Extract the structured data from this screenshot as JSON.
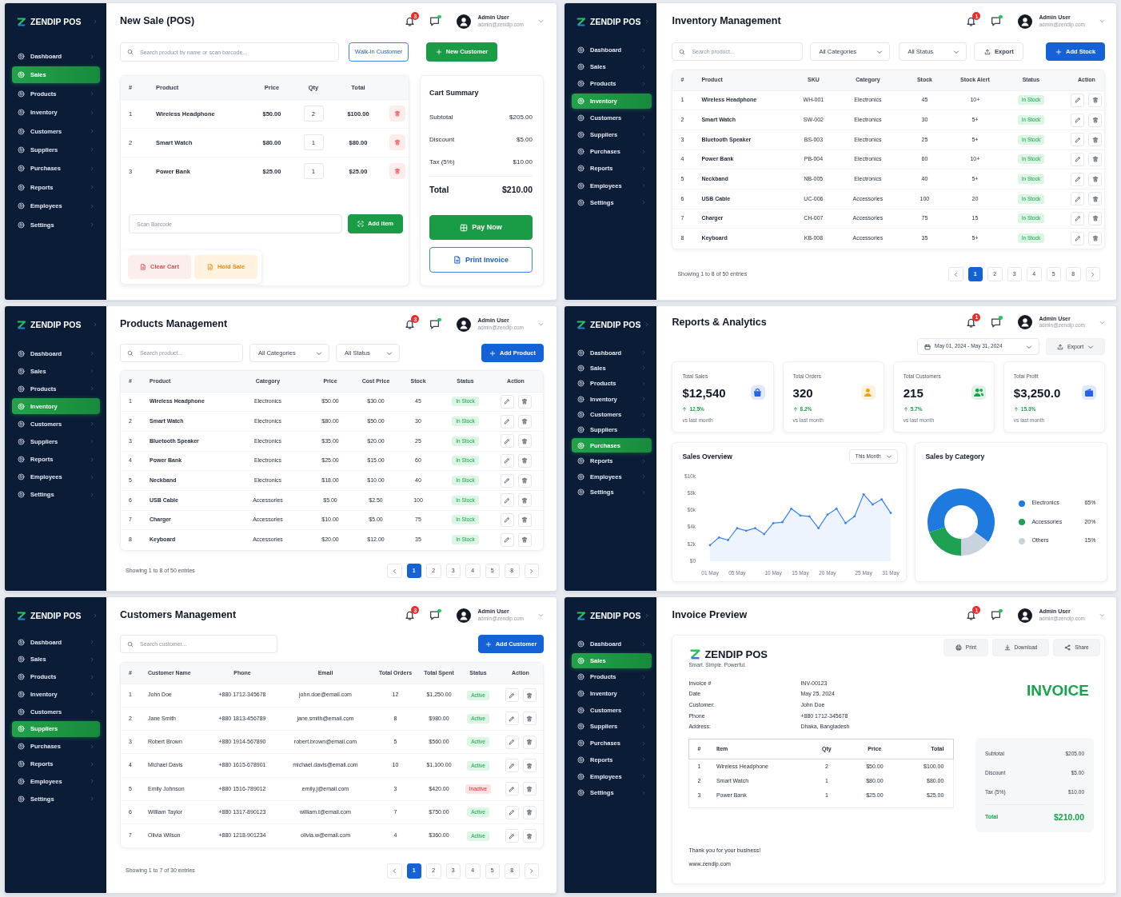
{
  "screens": [
    {
      "kind": "pos",
      "brand": "ZENDIP POS",
      "nav": [
        {
          "label": "Dashboard",
          "selected": false
        },
        {
          "label": "Sales",
          "selected": true
        },
        {
          "label": "Products",
          "selected": false
        },
        {
          "label": "Inventory",
          "selected": false
        },
        {
          "label": "Customers",
          "selected": false
        },
        {
          "label": "Suppliers",
          "selected": false
        },
        {
          "label": "Purchases",
          "selected": false
        },
        {
          "label": "Reports",
          "selected": false
        },
        {
          "label": "Employees",
          "selected": false
        },
        {
          "label": "Settings",
          "selected": false
        }
      ],
      "header": {
        "title": "New Sale (POS)",
        "notifications": "3",
        "user_name": "Admin User",
        "user_email": "admin@zendip.com"
      },
      "search": {
        "placeholder": "Search product by name or scan barcode..."
      },
      "customer_button": "Walk-in Customer",
      "new_customer_button": "New Customer",
      "cart": {
        "columns": [
          "#",
          "Product",
          "Price",
          "Qty",
          "Total"
        ],
        "rows": [
          [
            "1",
            "Wireless Headphone",
            "$50.00",
            "2",
            "$100.00"
          ],
          [
            "2",
            "Smart Watch",
            "$80.00",
            "1",
            "$80.00"
          ],
          [
            "3",
            "Power Bank",
            "$25.00",
            "1",
            "$25.00"
          ]
        ]
      },
      "barcode": {
        "placeholder": "Scan Barcode"
      },
      "add_item_button": "Add Item",
      "clear_cart_button": "Clear Cart",
      "hold_sale_button": "Hold Sale",
      "summary": {
        "title": "Cart Summary",
        "lines": [
          {
            "label": "Subtotal",
            "value": "$205.00"
          },
          {
            "label": "Discount",
            "value": "$5.00"
          },
          {
            "label": "Tax (5%)",
            "value": "$10.00"
          }
        ],
        "total": {
          "label": "Total",
          "value": "$210.00"
        }
      },
      "pay_button": "Pay Now",
      "print_button": "Print Invoice"
    },
    {
      "kind": "inventory",
      "brand": "ZENDIP POS",
      "nav": [
        {
          "label": "Dashboard",
          "selected": false
        },
        {
          "label": "Sales",
          "selected": false
        },
        {
          "label": "Products",
          "selected": false
        },
        {
          "label": "Inventory",
          "selected": true
        },
        {
          "label": "Customers",
          "selected": false
        },
        {
          "label": "Suppliers",
          "selected": false
        },
        {
          "label": "Purchases",
          "selected": false
        },
        {
          "label": "Reports",
          "selected": false
        },
        {
          "label": "Employees",
          "selected": false
        },
        {
          "label": "Settings",
          "selected": false
        }
      ],
      "header": {
        "title": "Inventory Management",
        "notifications": "1",
        "user_name": "Admin User",
        "user_email": "admin@zendip.com"
      },
      "toolbar": {
        "search_placeholder": "Search product...",
        "filters": [
          "All Categories",
          "All Status"
        ],
        "export_button": "Export",
        "add_button": "Add Stock"
      },
      "table": {
        "columns": [
          "#",
          "Product",
          "SKU",
          "Category",
          "Stock",
          "Stock Alert",
          "Status",
          "Action"
        ],
        "rows": [
          {
            "cells": [
              "1",
              "Wireless Headphone",
              "WH-001",
              "Electronics",
              "45",
              "10+"
            ],
            "status": "In Stock",
            "in_stock": true
          },
          {
            "cells": [
              "2",
              "Smart Watch",
              "SW-002",
              "Electronics",
              "30",
              "5+"
            ],
            "status": "In Stock",
            "in_stock": true
          },
          {
            "cells": [
              "3",
              "Bluetooth Speaker",
              "BS-003",
              "Electronics",
              "25",
              "5+"
            ],
            "status": "In Stock",
            "in_stock": true
          },
          {
            "cells": [
              "4",
              "Power Bank",
              "PB-004",
              "Electronics",
              "60",
              "10+"
            ],
            "status": "In Stock",
            "in_stock": true
          },
          {
            "cells": [
              "5",
              "Neckband",
              "NB-005",
              "Electronics",
              "40",
              "5+"
            ],
            "status": "In Stock",
            "in_stock": true
          },
          {
            "cells": [
              "6",
              "USB Cable",
              "UC-006",
              "Accessories",
              "100",
              "20"
            ],
            "status": "In Stock",
            "in_stock": true
          },
          {
            "cells": [
              "7",
              "Charger",
              "CH-007",
              "Accessories",
              "75",
              "15"
            ],
            "status": "In Stock",
            "in_stock": true
          },
          {
            "cells": [
              "8",
              "Keyboard",
              "KB-008",
              "Accessories",
              "35",
              "5+"
            ],
            "status": "In Stock",
            "in_stock": true
          }
        ]
      },
      "footer": {
        "summary": "Showing 1 to 8 of 50 entries",
        "pages": [
          {
            "label": "1",
            "selected": true
          },
          {
            "label": "2",
            "selected": false
          },
          {
            "label": "3",
            "selected": false
          },
          {
            "label": "4",
            "selected": false
          },
          {
            "label": "5",
            "selected": false
          },
          {
            "label": "8",
            "selected": false
          }
        ]
      }
    },
    {
      "kind": "products",
      "brand": "ZENDIP POS",
      "nav": [
        {
          "label": "Dashboard",
          "selected": false
        },
        {
          "label": "Sales",
          "selected": false
        },
        {
          "label": "Products",
          "selected": false
        },
        {
          "label": "Inventory",
          "selected": true
        },
        {
          "label": "Customers",
          "selected": false
        },
        {
          "label": "Suppliers",
          "selected": false
        },
        {
          "label": "Reports",
          "selected": false
        },
        {
          "label": "Employees",
          "selected": false
        },
        {
          "label": "Settings",
          "selected": false
        }
      ],
      "header": {
        "title": "Products Management",
        "notifications": "3",
        "user_name": "Admin User",
        "user_email": "admin@zendip.com"
      },
      "toolbar": {
        "search_placeholder": "Search product...",
        "filters": [
          "All Categories",
          "All Status"
        ],
        "add_button": "Add Product"
      },
      "table": {
        "columns": [
          "#",
          "Product",
          "Category",
          "Price",
          "Cost Price",
          "Stock",
          "Status",
          "Action"
        ],
        "rows": [
          {
            "cells": [
              "1",
              "Wireless Headphone",
              "Electronics",
              "$50.00",
              "$30.00",
              "45"
            ],
            "status": "In Stock",
            "in_stock": true
          },
          {
            "cells": [
              "2",
              "Smart Watch",
              "Electronics",
              "$80.00",
              "$50.00",
              "30"
            ],
            "status": "In Stock",
            "in_stock": true
          },
          {
            "cells": [
              "3",
              "Bluetooth Speaker",
              "Electronics",
              "$35.00",
              "$20.00",
              "25"
            ],
            "status": "In Stock",
            "in_stock": true
          },
          {
            "cells": [
              "4",
              "Power Bank",
              "Electronics",
              "$25.00",
              "$15.00",
              "60"
            ],
            "status": "In Stock",
            "in_stock": true
          },
          {
            "cells": [
              "5",
              "Neckband",
              "Electronics",
              "$18.00",
              "$10.00",
              "40"
            ],
            "status": "In Stock",
            "in_stock": true
          },
          {
            "cells": [
              "6",
              "USB Cable",
              "Accessories",
              "$5.00",
              "$2.50",
              "100"
            ],
            "status": "In Stock",
            "in_stock": true
          },
          {
            "cells": [
              "7",
              "Charger",
              "Accessories",
              "$10.00",
              "$5.00",
              "75"
            ],
            "status": "In Stock",
            "in_stock": true
          },
          {
            "cells": [
              "8",
              "Keyboard",
              "Accessories",
              "$20.00",
              "$12.00",
              "35"
            ],
            "status": "In Stock",
            "in_stock": true
          }
        ]
      },
      "footer": {
        "summary": "Showing 1 to 8 of 50 entries",
        "pages": [
          {
            "label": "1",
            "selected": true
          },
          {
            "label": "2",
            "selected": false
          },
          {
            "label": "3",
            "selected": false
          },
          {
            "label": "4",
            "selected": false
          },
          {
            "label": "5",
            "selected": false
          },
          {
            "label": "8",
            "selected": false
          }
        ]
      }
    },
    {
      "kind": "reports",
      "brand": "ZENDIP POS",
      "nav": [
        {
          "label": "Dashboard",
          "selected": false
        },
        {
          "label": "Sales",
          "selected": false
        },
        {
          "label": "Products",
          "selected": false
        },
        {
          "label": "Inventory",
          "selected": false
        },
        {
          "label": "Customers",
          "selected": false
        },
        {
          "label": "Suppliers",
          "selected": false
        },
        {
          "label": "Purchases",
          "selected": true
        },
        {
          "label": "Reports",
          "selected": false
        },
        {
          "label": "Employees",
          "selected": false
        },
        {
          "label": "Settings",
          "selected": false
        }
      ],
      "header": {
        "title": "Reports & Analytics",
        "notifications": "1",
        "user_name": "Admin User",
        "user_email": "admin@zendip.com"
      },
      "date_range": "May 01, 2024 - May 31, 2024",
      "export_button": "Export",
      "stats": [
        {
          "label": "Total Sales",
          "value": "$12,540",
          "change": "12.5%",
          "note": "vs last month",
          "color": "#2563eb"
        },
        {
          "label": "Total Orders",
          "value": "320",
          "change": "8.2%",
          "note": "vs last month",
          "color": "#f59e0b"
        },
        {
          "label": "Total Customers",
          "value": "215",
          "change": "5.7%",
          "note": "vs last month",
          "color": "#16a34a"
        },
        {
          "label": "Total Profit",
          "value": "$3,250.0",
          "change": "15.3%",
          "note": "vs last month",
          "color": "#2563eb"
        }
      ],
      "sales_chart": {
        "period": "This Month",
        "chart_data": {
          "type": "area",
          "title": "Sales Overview",
          "categories": [
            "01 May",
            null,
            null,
            "05 May",
            null,
            null,
            null,
            "10 May",
            null,
            null,
            "15 May",
            null,
            null,
            "20 May",
            null,
            null,
            null,
            "25 May",
            null,
            null,
            "31 May"
          ],
          "series": [
            {
              "color": "#3b82f6",
              "values": [
                1900,
                2800,
                2500,
                3900,
                3600,
                3900,
                3200,
                4500,
                4600,
                6200,
                5400,
                5300,
                3900,
                5500,
                6200,
                4500,
                5300,
                7900,
                6700,
                7300,
                5700
              ]
            }
          ],
          "ylim": [
            0,
            10000
          ],
          "yticks": [
            {
              "value": 0,
              "label": "$0"
            },
            {
              "value": 2000,
              "label": "$2k"
            },
            {
              "value": 4000,
              "label": "$4k"
            },
            {
              "value": 6000,
              "label": "$6k"
            },
            {
              "value": 8000,
              "label": "$8k"
            },
            {
              "value": 10000,
              "label": "$10k"
            }
          ]
        }
      },
      "category_chart": {
        "chart_data": {
          "type": "donut",
          "title": "Sales by Category",
          "categories": [
            "Electronics",
            "Accessories",
            "Others"
          ],
          "values": [
            65,
            20,
            15
          ],
          "value_labels": [
            "65%",
            "20%",
            "15%"
          ]
        },
        "slices": [
          {
            "color": "#1f7ae0"
          },
          {
            "color": "#1fa152"
          },
          {
            "color": "#c9d3de"
          }
        ]
      }
    },
    {
      "kind": "customers",
      "brand": "ZENDIP POS",
      "nav": [
        {
          "label": "Dashboard",
          "selected": false
        },
        {
          "label": "Sales",
          "selected": false
        },
        {
          "label": "Products",
          "selected": false
        },
        {
          "label": "Inventory",
          "selected": false
        },
        {
          "label": "Customers",
          "selected": false
        },
        {
          "label": "Suppliers",
          "selected": true
        },
        {
          "label": "Purchases",
          "selected": false
        },
        {
          "label": "Reports",
          "selected": false
        },
        {
          "label": "Employees",
          "selected": false
        },
        {
          "label": "Settings",
          "selected": false
        }
      ],
      "header": {
        "title": "Customers Management",
        "notifications": "3",
        "user_name": "Admin User",
        "user_email": "admin@zendip.com"
      },
      "toolbar": {
        "search_placeholder": "Search customer...",
        "add_button": "Add Customer"
      },
      "table": {
        "columns": [
          "#",
          "Customer Name",
          "Phone",
          "Email",
          "Total Orders",
          "Total Spent",
          "Status",
          "Action"
        ],
        "rows": [
          {
            "cells": [
              "1",
              "John Doe",
              "+880 1712-345678",
              "john.doe@email.com",
              "12",
              "$1,250.00"
            ],
            "status": "Active",
            "active": true
          },
          {
            "cells": [
              "2",
              "Jane Smith",
              "+880 1813-456789",
              "jane.smith@email.com",
              "8",
              "$980.00"
            ],
            "status": "Active",
            "active": true
          },
          {
            "cells": [
              "3",
              "Robert Brown",
              "+880 1914-567890",
              "robert.brown@email.com",
              "5",
              "$560.00"
            ],
            "status": "Active",
            "active": true
          },
          {
            "cells": [
              "4",
              "Michael Davis",
              "+880 1615-678901",
              "michael.davis@email.com",
              "10",
              "$1,100.00"
            ],
            "status": "Active",
            "active": true
          },
          {
            "cells": [
              "5",
              "Emily Johnson",
              "+880 1516-789012",
              "emily.j@email.com",
              "3",
              "$420.00"
            ],
            "status": "Inactive",
            "active": false
          },
          {
            "cells": [
              "6",
              "William Taylor",
              "+880 1317-890123",
              "william.t@email.com",
              "7",
              "$750.00"
            ],
            "status": "Active",
            "active": true
          },
          {
            "cells": [
              "7",
              "Olivia Wilson",
              "+880 1218-901234",
              "olivia.w@email.com",
              "4",
              "$360.00"
            ],
            "status": "Active",
            "active": true
          }
        ]
      },
      "footer": {
        "summary": "Showing 1 to 7 of 30 entries",
        "pages": [
          {
            "label": "1",
            "selected": true
          },
          {
            "label": "2",
            "selected": false
          },
          {
            "label": "3",
            "selected": false
          },
          {
            "label": "4",
            "selected": false
          },
          {
            "label": "5",
            "selected": false
          },
          {
            "label": "8",
            "selected": false
          }
        ]
      }
    },
    {
      "kind": "invoice",
      "brand": "ZENDIP POS",
      "nav": [
        {
          "label": "Dashboard",
          "selected": false
        },
        {
          "label": "Sales",
          "selected": true
        },
        {
          "label": "Products",
          "selected": false
        },
        {
          "label": "Inventory",
          "selected": false
        },
        {
          "label": "Customers",
          "selected": false
        },
        {
          "label": "Suppliers",
          "selected": false
        },
        {
          "label": "Purchases",
          "selected": false
        },
        {
          "label": "Reports",
          "selected": false
        },
        {
          "label": "Employees",
          "selected": false
        },
        {
          "label": "Settings",
          "selected": false
        }
      ],
      "header": {
        "title": "Invoice Preview",
        "notifications": "1",
        "user_name": "Admin User",
        "user_email": "admin@zendip.com"
      },
      "actions": [
        {
          "kind": "print",
          "label": "Print"
        },
        {
          "kind": "download",
          "label": "Download"
        },
        {
          "kind": "share",
          "label": "Share"
        }
      ],
      "invoice": {
        "brand": "ZENDIP POS",
        "tagline": "Smart. Simple. Powerful.",
        "doc_title": "INVOICE",
        "fields": [
          {
            "label": "Invoice #",
            "value": "INV-00123"
          },
          {
            "label": "Date",
            "value": "May 25, 2024"
          },
          {
            "label": "Customer:",
            "value": "John Doe"
          },
          {
            "label": "Phone",
            "value": "+880 1712-345678"
          },
          {
            "label": "Address:",
            "value": "Dhaka, Bangladesh"
          }
        ],
        "items": {
          "columns": [
            "#",
            "Item",
            "Qty",
            "Price",
            "Total"
          ],
          "rows": [
            [
              "1",
              "Wireless Headphone",
              "2",
              "$50.00",
              "$100.00"
            ],
            [
              "2",
              "Smart Watch",
              "1",
              "$80.00",
              "$80.00"
            ],
            [
              "3",
              "Power Bank",
              "1",
              "$25.00",
              "$25.00"
            ]
          ]
        },
        "summary": {
          "lines": [
            {
              "label": "Subtotal",
              "value": "$205.00"
            },
            {
              "label": "Discount",
              "value": "$5.00"
            },
            {
              "label": "Tax (5%)",
              "value": "$10.00"
            }
          ],
          "total": {
            "label": "Total",
            "value": "$210.00"
          }
        },
        "thanks": "Thank you for your business!",
        "website": "www.zendip.com"
      }
    }
  ]
}
